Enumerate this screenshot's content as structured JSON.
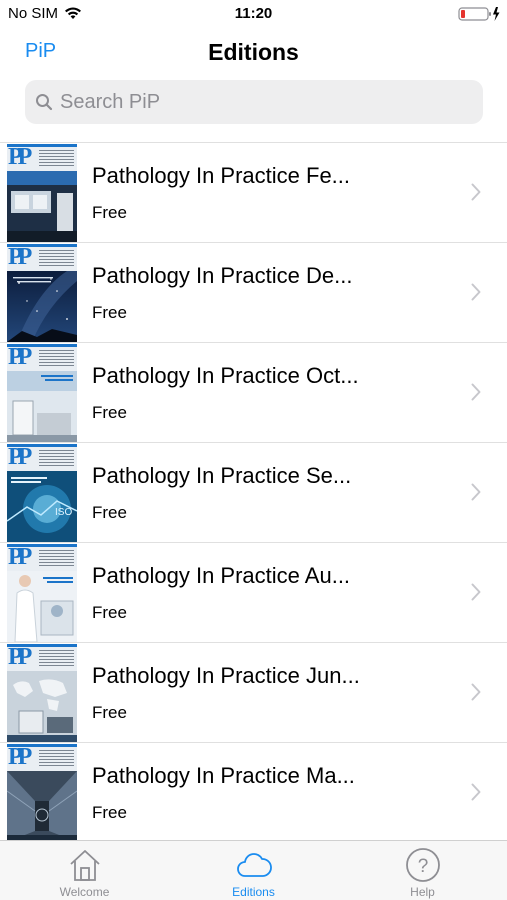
{
  "status_bar": {
    "carrier": "No SIM",
    "time": "11:20"
  },
  "nav": {
    "back_label": "PiP",
    "title": "Editions"
  },
  "search": {
    "placeholder": "Search PiP"
  },
  "editions": [
    {
      "title": "Pathology In Practice Fe...",
      "price": "Free",
      "art": "lab-panel"
    },
    {
      "title": "Pathology In Practice De...",
      "price": "Free",
      "art": "night-sky"
    },
    {
      "title": "Pathology In Practice Oct...",
      "price": "Free",
      "art": "lab-bench"
    },
    {
      "title": "Pathology In Practice Se...",
      "price": "Free",
      "art": "digital-tech"
    },
    {
      "title": "Pathology In Practice Au...",
      "price": "Free",
      "art": "lab-scientist"
    },
    {
      "title": "Pathology In Practice Jun...",
      "price": "Free",
      "art": "world-map"
    },
    {
      "title": "Pathology In Practice Ma...",
      "price": "Free",
      "art": "corridor"
    }
  ],
  "tabs": [
    {
      "label": "Welcome",
      "icon": "house-icon",
      "active": false
    },
    {
      "label": "Editions",
      "icon": "cloud-icon",
      "active": true
    },
    {
      "label": "Help",
      "icon": "question-circle-icon",
      "active": false
    }
  ],
  "colors": {
    "accent": "#1a8cf0",
    "inactive": "#8e8e93",
    "battery_low": "#e5342f"
  }
}
